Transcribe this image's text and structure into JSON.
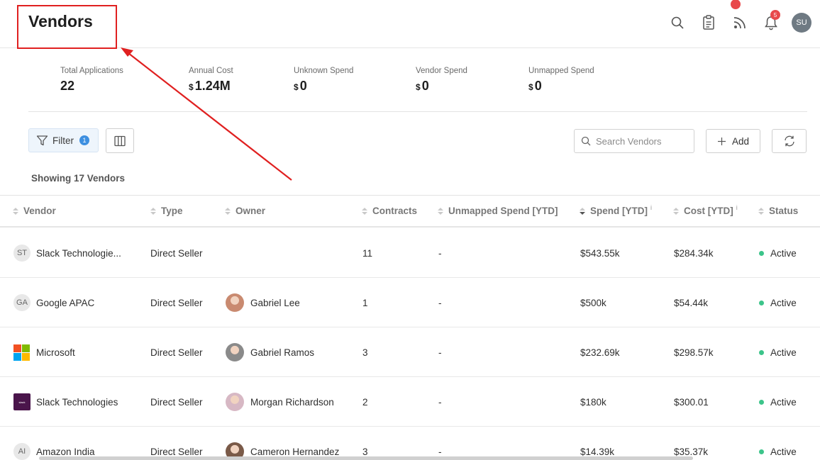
{
  "header": {
    "title": "Vendors",
    "icons": [
      "search-icon",
      "clipboard-icon",
      "rss-icon",
      "bell-icon"
    ],
    "notification_count": "5",
    "user_initials": "SU"
  },
  "stats": [
    {
      "label": "Total Applications",
      "currency": "",
      "value": "22"
    },
    {
      "label": "Annual Cost",
      "currency": "$",
      "value": "1.24M"
    },
    {
      "label": "Unknown Spend",
      "currency": "$",
      "value": "0"
    },
    {
      "label": "Vendor Spend",
      "currency": "$",
      "value": "0"
    },
    {
      "label": "Unmapped Spend",
      "currency": "$",
      "value": "0"
    }
  ],
  "toolbar": {
    "filter_label": "Filter",
    "filter_count": "1",
    "search_placeholder": "Search Vendors",
    "add_label": "Add"
  },
  "showing_text": "Showing 17 Vendors",
  "table": {
    "columns": [
      "Vendor",
      "Type",
      "Owner",
      "Contracts",
      "Unmapped Spend [YTD]",
      "Spend [YTD]",
      "Cost [YTD]",
      "Status"
    ],
    "rows": [
      {
        "logo": "ST",
        "logo_type": "initials",
        "vendor": "Slack Technologie...",
        "type": "Direct Seller",
        "owner": "",
        "contracts": "11",
        "unmapped": "-",
        "spend": "$543.55k",
        "cost": "$284.34k",
        "status": "Active"
      },
      {
        "logo": "GA",
        "logo_type": "initials",
        "vendor": "Google APAC",
        "type": "Direct Seller",
        "owner": "Gabriel Lee",
        "contracts": "1",
        "unmapped": "-",
        "spend": "$500k",
        "cost": "$54.44k",
        "status": "Active"
      },
      {
        "logo": "",
        "logo_type": "microsoft",
        "vendor": "Microsoft",
        "type": "Direct Seller",
        "owner": "Gabriel Ramos",
        "contracts": "3",
        "unmapped": "-",
        "spend": "$232.69k",
        "cost": "$298.57k",
        "status": "Active"
      },
      {
        "logo": "slack",
        "logo_type": "slack",
        "vendor": "Slack Technologies",
        "type": "Direct Seller",
        "owner": "Morgan Richardson",
        "contracts": "2",
        "unmapped": "-",
        "spend": "$180k",
        "cost": "$300.01",
        "status": "Active"
      },
      {
        "logo": "AI",
        "logo_type": "initials",
        "vendor": "Amazon India",
        "type": "Direct Seller",
        "owner": "Cameron Hernandez",
        "contracts": "3",
        "unmapped": "-",
        "spend": "$14.39k",
        "cost": "$35.37k",
        "status": "Active"
      }
    ]
  },
  "colors": {
    "annotation": "#e02020",
    "accent": "#3d8fe0",
    "status_active": "#3cc48a",
    "badge": "#e8484b"
  }
}
